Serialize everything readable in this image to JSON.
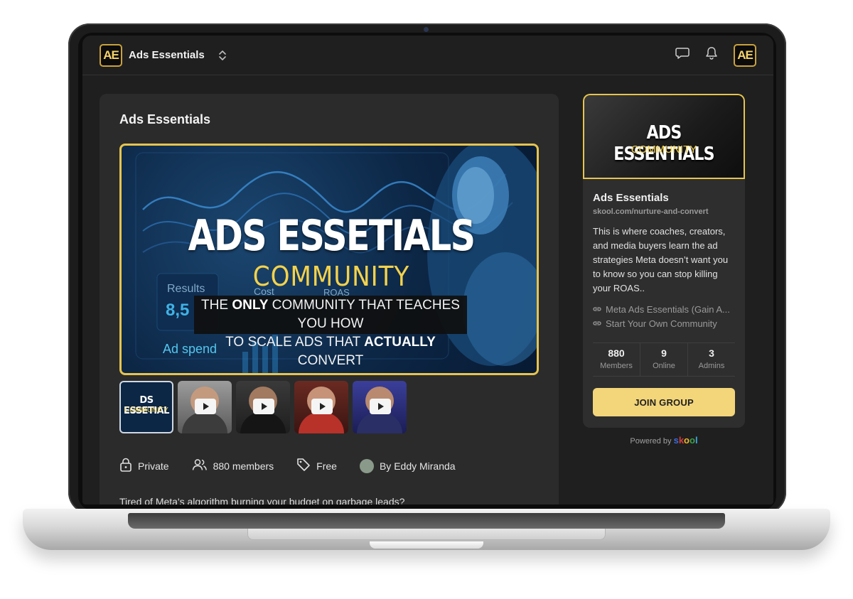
{
  "header": {
    "logo_text": "AE",
    "app_name": "Ads Essentials",
    "icons": [
      "chevron-up-down-icon",
      "chat-icon",
      "bell-icon"
    ],
    "avatar_text": "AE"
  },
  "main": {
    "title": "Ads Essentials",
    "hero": {
      "title": "ADS ESSETIALS",
      "subtitle": "COMMUNITY",
      "tagline_line1_pre": "THE ",
      "tagline_line1_bold": "ONLY",
      "tagline_line1_post": " COMMUNITY THAT TEACHES YOU HOW",
      "tagline_line2_pre": "TO SCALE ADS THAT ",
      "tagline_line2_bold": "ACTUALLY",
      "tagline_line2_post": " CONVERT",
      "stat_results": "Results",
      "stat_cost": "Cost",
      "stat_roas": "ROAS",
      "stat_value": "8,5",
      "ad_spend": "Ad spend"
    },
    "thumbnails": [
      {
        "title": "DS ESSETIAL",
        "sub": "COMMUNITY"
      },
      {
        "type": "video"
      },
      {
        "type": "video"
      },
      {
        "type": "video"
      },
      {
        "type": "video"
      }
    ],
    "meta": {
      "privacy": "Private",
      "members": "880 members",
      "price": "Free",
      "owner": "By Eddy Miranda"
    },
    "description": "Tired of Meta's algorithm burning your budget on garbage leads?"
  },
  "sidebar": {
    "banner_title": "ADS ESSENTIALS",
    "banner_sub": "COMMUNITY",
    "name": "Ads Essentials",
    "url": "skool.com/nurture-and-convert",
    "description": "This is where coaches, creators, and media buyers learn the ad strategies Meta doesn’t want you to know so you can stop killing your ROAS..",
    "links": [
      "Meta Ads Essentials (Gain A...",
      "Start Your Own Community"
    ],
    "stats": [
      {
        "value": "880",
        "label": "Members"
      },
      {
        "value": "9",
        "label": "Online"
      },
      {
        "value": "3",
        "label": "Admins"
      }
    ],
    "join_label": "JOIN GROUP",
    "powered_by": "Powered by",
    "brand": "skool"
  },
  "colors": {
    "accent_gold": "#e6c44e",
    "button_gold": "#f3d57a",
    "card_bg": "#2b2b2b",
    "screen_bg": "#1f1f1f"
  }
}
